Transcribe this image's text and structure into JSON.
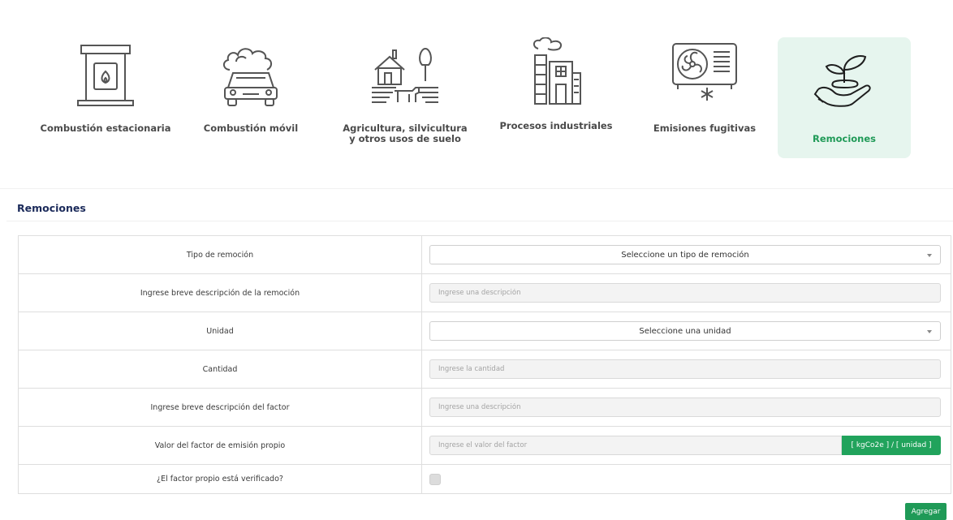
{
  "categories": [
    {
      "label": "Combustión estacionaria",
      "icon": "fireplace-icon",
      "active": false
    },
    {
      "label": "Combustión móvil",
      "icon": "car-smoke-icon",
      "active": false
    },
    {
      "label": "Agricultura, silvicultura y otros usos de suelo",
      "icon": "farm-icon",
      "active": false
    },
    {
      "label": "Procesos industriales",
      "icon": "factory-icon",
      "active": false
    },
    {
      "label": "Emisiones fugitivas",
      "icon": "air-conditioner-icon",
      "active": false
    },
    {
      "label": "Remociones",
      "icon": "plant-in-hand-icon",
      "active": true
    }
  ],
  "colors": {
    "accent": "#1f9a57",
    "active_bg": "#e6f5ee",
    "title": "#1b2a5a"
  },
  "section": {
    "title": "Remociones"
  },
  "form": {
    "removal_type": {
      "label": "Tipo de remoción",
      "value": "Seleccione un tipo de remoción"
    },
    "removal_description": {
      "label": "Ingrese breve descripción de la remoción",
      "placeholder": "Ingrese una descripción"
    },
    "unit": {
      "label": "Unidad",
      "value": "Seleccione una unidad"
    },
    "quantity": {
      "label": "Cantidad",
      "placeholder": "Ingrese la cantidad"
    },
    "factor_description": {
      "label": "Ingrese breve descripción del factor",
      "placeholder": "Ingrese una descripción"
    },
    "factor_value": {
      "label": "Valor del factor de emisión propio",
      "placeholder": "Ingrese el valor del factor",
      "unit_addon": "[ kgCo2e ] / [ unidad ]"
    },
    "verified": {
      "label": "¿El factor propio está verificado?",
      "checked": false
    }
  },
  "actions": {
    "add_label": "Agregar"
  }
}
